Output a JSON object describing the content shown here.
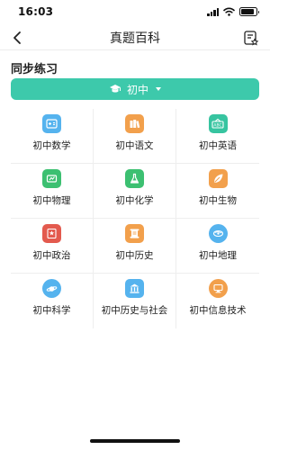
{
  "status_bar": {
    "time": "16:03",
    "signal_icon": "cellular-signal-icon",
    "wifi_icon": "wifi-icon",
    "battery_icon": "battery-icon",
    "battery_level": 0.85
  },
  "nav": {
    "back_icon": "chevron-left-icon",
    "title": "真题百科",
    "action_icon": "starred-list-icon"
  },
  "section": {
    "title": "同步练习"
  },
  "grade_select": {
    "icon": "graduation-cap-icon",
    "value": "初中",
    "caret_icon": "caret-down-icon"
  },
  "colors": {
    "accent": "#3dc9ab",
    "blue": "#55b3ee",
    "orange": "#f2a04c",
    "teal": "#37c4a0",
    "green": "#3cc071",
    "red": "#e35a4e"
  },
  "subjects": [
    {
      "label": "初中数学",
      "icon": "calculator-icon",
      "color": "#55b3ee"
    },
    {
      "label": "初中语文",
      "icon": "books-icon",
      "color": "#f2a04c"
    },
    {
      "label": "初中英语",
      "icon": "abc-icon",
      "color": "#37c4a0"
    },
    {
      "label": "初中物理",
      "icon": "magnet-icon",
      "color": "#3cc071"
    },
    {
      "label": "初中化学",
      "icon": "flask-icon",
      "color": "#3cc071"
    },
    {
      "label": "初中生物",
      "icon": "leaf-icon",
      "color": "#f2a04c"
    },
    {
      "label": "初中政治",
      "icon": "emblem-icon",
      "color": "#e35a4e"
    },
    {
      "label": "初中历史",
      "icon": "history-scroll-icon",
      "color": "#f2a04c"
    },
    {
      "label": "初中地理",
      "icon": "globe-icon",
      "color": "#55b3ee"
    },
    {
      "label": "初中科学",
      "icon": "planet-icon",
      "color": "#55b3ee"
    },
    {
      "label": "初中历史与社会",
      "icon": "building-icon",
      "color": "#55b3ee"
    },
    {
      "label": "初中信息技术",
      "icon": "computer-icon",
      "color": "#f2a04c"
    }
  ]
}
